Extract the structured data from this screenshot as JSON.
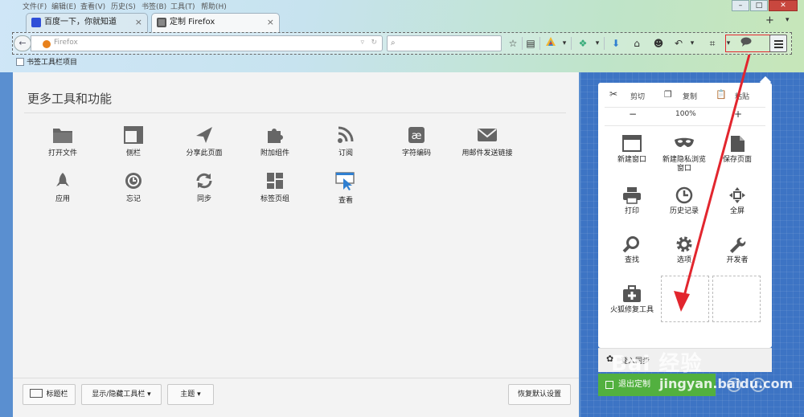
{
  "window": {
    "menu": [
      "文件(F)",
      "编辑(E)",
      "查看(V)",
      "历史(S)",
      "书签(B)",
      "工具(T)",
      "帮助(H)"
    ],
    "tabs": [
      {
        "label": "百度一下，你就知道",
        "close": "×"
      },
      {
        "label": "定制 Firefox",
        "close": "×"
      }
    ],
    "new_tab": "+",
    "tab_list_arrow": "▾"
  },
  "navbar": {
    "back": "←",
    "url_text": "Firefox",
    "search_placeholder": ""
  },
  "bookmarks": {
    "item": "书签工具栏项目"
  },
  "main": {
    "title": "更多工具和功能",
    "tools": [
      {
        "label": "打开文件",
        "icon": "folder-icon"
      },
      {
        "label": "侧栏",
        "icon": "sidebar-icon"
      },
      {
        "label": "分享此页面",
        "icon": "share-icon"
      },
      {
        "label": "附加组件",
        "icon": "puzzle-icon"
      },
      {
        "label": "订阅",
        "icon": "rss-icon"
      },
      {
        "label": "字符编码",
        "icon": "encoding-icon"
      },
      {
        "label": "用邮件发送链接",
        "icon": "mail-icon"
      },
      {
        "label": "应用",
        "icon": "rocket-icon"
      },
      {
        "label": "忘记",
        "icon": "forget-icon"
      },
      {
        "label": "同步",
        "icon": "sync-icon"
      },
      {
        "label": "标签页组",
        "icon": "tab-groups-icon"
      },
      {
        "label": "查看",
        "icon": "inspect-icon"
      }
    ],
    "bottom": {
      "title_bar": "标题栏",
      "toolbars": "显示/隐藏工具栏 ▾",
      "themes": "主题 ▾",
      "restore": "恢复默认设置"
    }
  },
  "panel": {
    "cut": "剪切",
    "copy": "复制",
    "paste": "粘贴",
    "zoom_out": "−",
    "zoom": "100%",
    "zoom_in": "+",
    "items": [
      {
        "label": "新建窗口",
        "icon": "new-window-icon"
      },
      {
        "label": "新建隐私浏览\n窗口",
        "icon": "private-window-icon"
      },
      {
        "label": "保存页面",
        "icon": "save-page-icon"
      },
      {
        "label": "打印",
        "icon": "print-icon"
      },
      {
        "label": "历史记录",
        "icon": "history-icon"
      },
      {
        "label": "全屏",
        "icon": "fullscreen-icon"
      },
      {
        "label": "查找",
        "icon": "find-icon"
      },
      {
        "label": "选项",
        "icon": "options-icon"
      },
      {
        "label": "开发者",
        "icon": "developer-icon"
      },
      {
        "label": "火狐修复工具",
        "icon": "toolbox-icon"
      }
    ],
    "sign_in": "登入同步",
    "exit_customize": "退出定制"
  },
  "watermark": {
    "line1": "Bai 经验",
    "line2": "jingyan.baidu.com"
  },
  "colors": {
    "accent_red": "#e2262e",
    "exit_green": "#52b03f",
    "customize_bg": "#3d74c4"
  }
}
